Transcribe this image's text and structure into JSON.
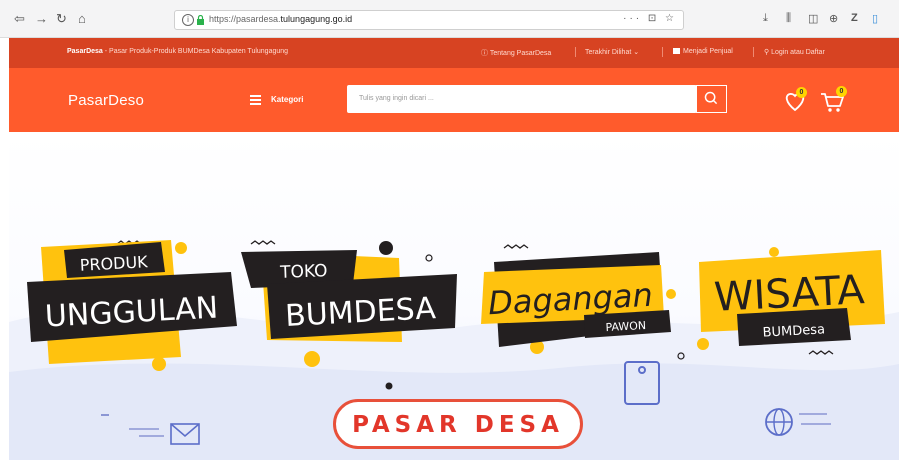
{
  "browser": {
    "url_prefix": "https://pasardesa.",
    "url_domain": "tulungagung.go.id",
    "url_actions": "··· ⊡ ☆"
  },
  "topstrip": {
    "brand": "PasarDesa",
    "tagline": " - Pasar Produk-Produk BUMDesa Kabupaten Tulungagung",
    "links": [
      "Tentang PasarDesa",
      "Terakhir Dilihat",
      "Menjadi Penjual",
      "Login atau Daftar"
    ]
  },
  "mainbar": {
    "logo": "PasarDeso",
    "menu_label": "Kategori",
    "search_placeholder": "Tulis yang ingin dicari ...",
    "wishlist_count": "0",
    "cart_count": "0"
  },
  "hero": {
    "banners": [
      {
        "small": "PRODUK",
        "big": "UNGGULAN"
      },
      {
        "small": "TOKO",
        "big": "BUMDESA"
      },
      {
        "big": "Dagangan",
        "small": "PAWON"
      },
      {
        "big": "WISATA",
        "small": "BUMDesa"
      }
    ],
    "logo_text": "PASAR DESA"
  },
  "colors": {
    "strip": "#d74322",
    "mainbar": "#ff5b2c",
    "banner_yellow": "#ffc20e",
    "banner_dark": "#231f20",
    "pasar_desa_red": "#e2362a"
  }
}
